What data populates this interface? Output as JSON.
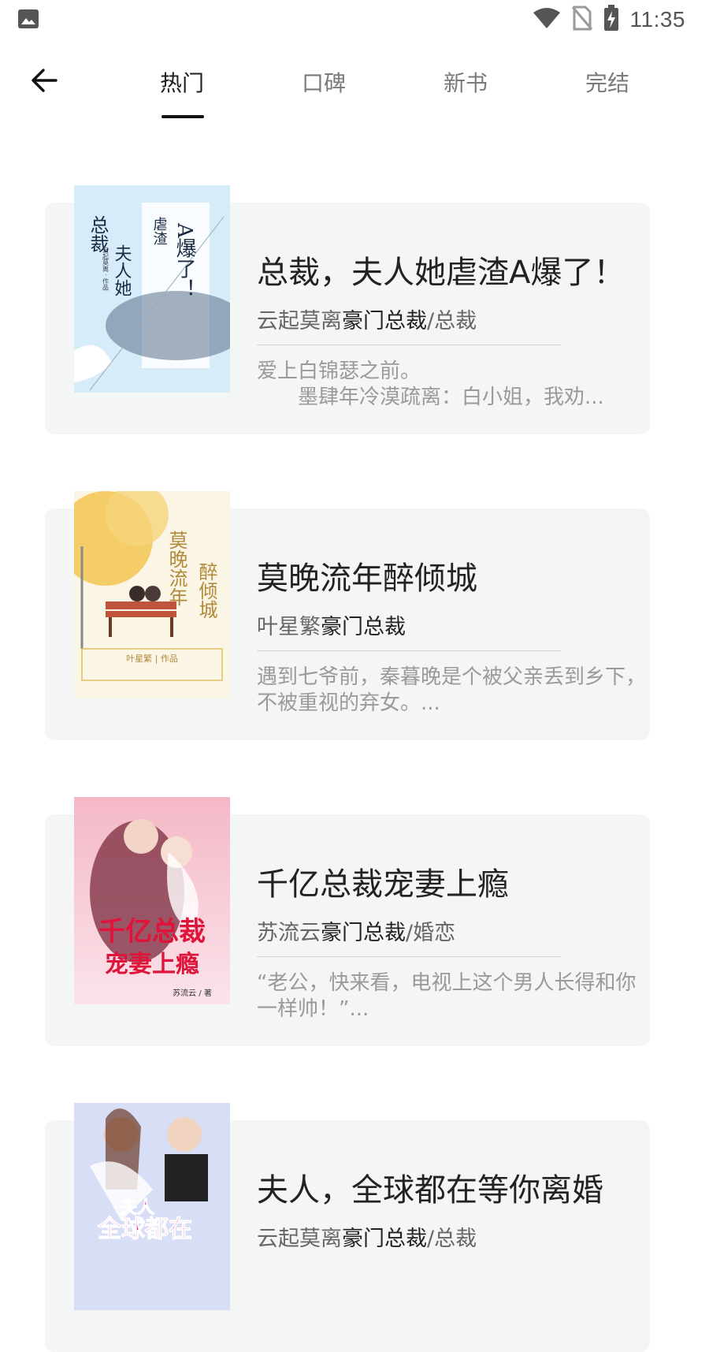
{
  "status_bar": {
    "time": "11:35",
    "icons": [
      "image-icon",
      "wifi-icon",
      "no-sim-icon",
      "battery-charging-icon"
    ]
  },
  "nav": {
    "back_icon": "back-arrow-icon",
    "tabs": [
      {
        "label": "热门",
        "active": true
      },
      {
        "label": "口碑",
        "active": false
      },
      {
        "label": "新书",
        "active": false
      },
      {
        "label": "完结",
        "active": false
      }
    ]
  },
  "books": [
    {
      "title": "总裁，夫人她虐渣A爆了！",
      "author": "云起莫离",
      "genre": "豪门总裁",
      "subgenre": "/总裁",
      "description": "爱上白锦瑟之前。\n　　墨肆年冷漠疏离：白小姐，我劝...",
      "cover_text": [
        "总裁",
        "夫人她",
        "虐渣",
        "A爆了！",
        "云起莫离 · 作品"
      ],
      "cover_color": "#cfe6f5"
    },
    {
      "title": "莫晚流年醉倾城",
      "author": "叶星繁",
      "genre": "豪门总裁",
      "subgenre": "",
      "description": "遇到七爷前，秦暮晚是个被父亲丢到乡下，不被重视的弃女。...",
      "cover_text": [
        "莫晚流年",
        "醉倾城",
        "叶星繁 | 作品"
      ],
      "cover_color": "#f8f1e0"
    },
    {
      "title": "千亿总裁宠妻上瘾",
      "author": "苏流云",
      "genre": "豪门总裁",
      "subgenre": "/婚恋",
      "description": "“老公，快来看，电视上这个男人长得和你一样帅！”...",
      "cover_text": [
        "千亿总裁",
        "宠妻上瘾",
        "苏流云 / 著"
      ],
      "cover_color": "#f6c9d2"
    },
    {
      "title": "夫人，全球都在等你离婚",
      "author": "云起莫离",
      "genre": "豪门总裁",
      "subgenre": "/总裁",
      "description": "",
      "cover_text": [
        "夫人",
        "全球都在"
      ],
      "cover_color": "#cfd6f2"
    }
  ]
}
